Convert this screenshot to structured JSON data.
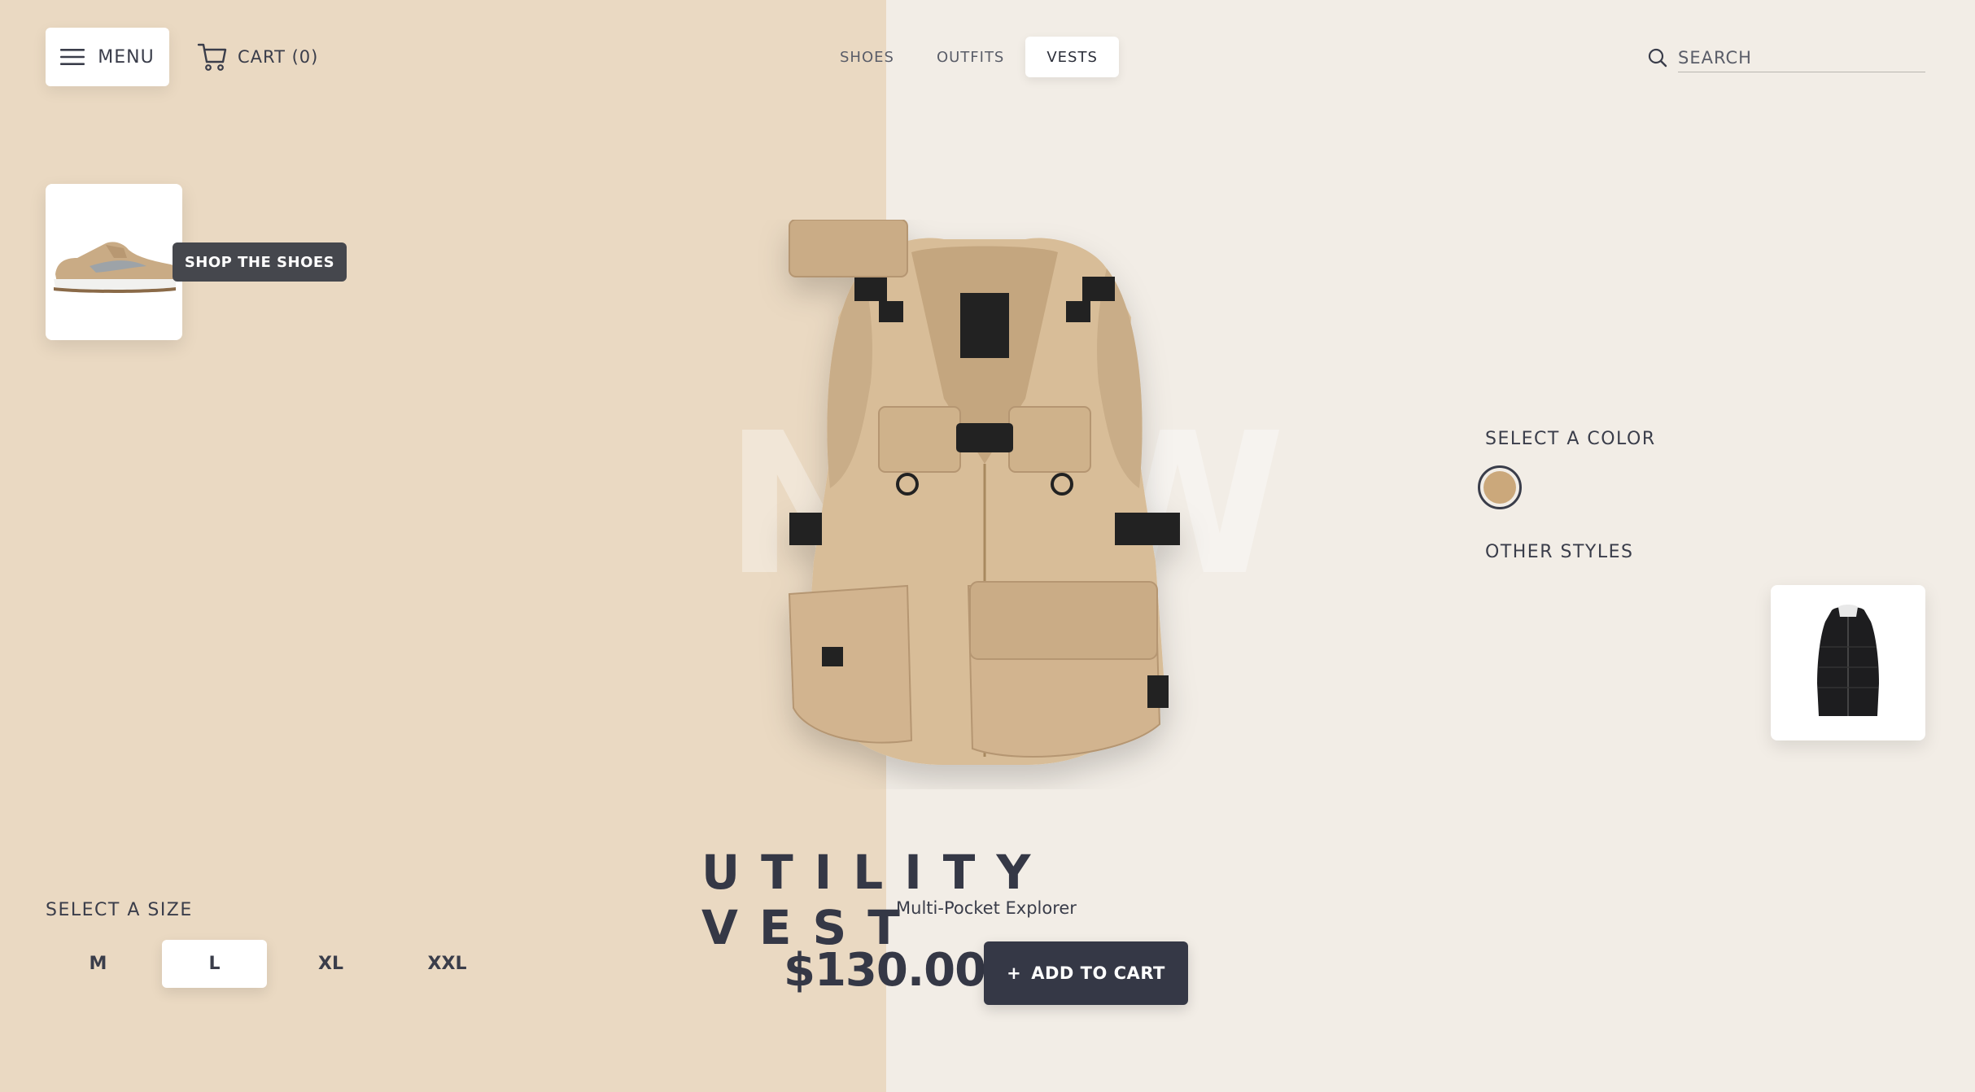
{
  "header": {
    "menu_label": "MENU",
    "cart_label": "CART (0)",
    "nav_tabs": [
      {
        "label": "SHOES",
        "active": false
      },
      {
        "label": "OUTFITS",
        "active": false
      },
      {
        "label": "VESTS",
        "active": true
      }
    ],
    "search": {
      "placeholder": "SEARCH",
      "value": ""
    }
  },
  "promo": {
    "shop_label": "SHOP THE SHOES",
    "shoe_icon": "sneaker-thumbnail"
  },
  "product": {
    "title": "UTILITY VEST",
    "subtitle": "Multi-Pocket Explorer",
    "price": "$130.00",
    "add_to_cart_label": "ADD TO CART",
    "add_icon": "+",
    "ghost_text": "NEW"
  },
  "options": {
    "color_title": "SELECT A COLOR",
    "colors": [
      {
        "name": "tan",
        "hex": "#cba87b",
        "selected": true
      }
    ],
    "other_styles_title": "OTHER STYLES",
    "size_title": "SELECT A SIZE",
    "sizes": [
      {
        "label": "M",
        "selected": false
      },
      {
        "label": "L",
        "selected": true
      },
      {
        "label": "XL",
        "selected": false
      },
      {
        "label": "XXL",
        "selected": false
      }
    ]
  },
  "theme": {
    "left_bg": "#ead9c2",
    "right_bg": "#f2ede6",
    "dark": "#353846",
    "vest": "#d8bd98"
  }
}
